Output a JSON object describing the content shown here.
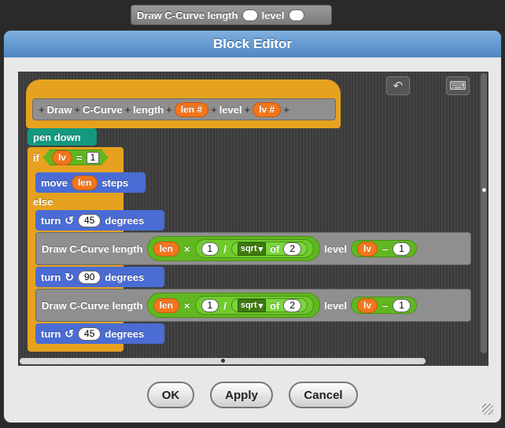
{
  "palette_block": {
    "name": "Draw C-Curve length",
    "param": "level"
  },
  "dialog": {
    "title": "Block Editor"
  },
  "toolbar": {
    "undo_icon": "undo-icon",
    "keyboard_icon": "keyboard-icon"
  },
  "prototype": {
    "sep": "+",
    "word1": "Draw",
    "word2": "C-Curve",
    "word3": "length",
    "input1": "len #",
    "word4": "level",
    "input2": "lv #"
  },
  "blocks": {
    "pen_down": "pen down",
    "if": "if",
    "eq_var": "lv",
    "eq_op": "=",
    "eq_val": "1",
    "move": "move",
    "move_var": "len",
    "steps": "steps",
    "else": "else",
    "turn": "turn",
    "degrees": "degrees",
    "turn1_val": "45",
    "turn2_val": "90",
    "turn3_val": "45",
    "draw_call": "Draw C-Curve length",
    "len": "len",
    "times": "×",
    "one": "1",
    "slash": "/",
    "sqrt": "sqrt",
    "of": "of",
    "two": "2",
    "level": "level",
    "lv": "lv",
    "minus": "–"
  },
  "buttons": {
    "ok": "OK",
    "apply": "Apply",
    "cancel": "Cancel"
  },
  "colors": {
    "control": "#e6a21e",
    "pen": "#149980",
    "motion": "#4a6cd4",
    "operators": "#60b71f",
    "variables": "#f3761d",
    "custom": "#8f8f8f"
  }
}
